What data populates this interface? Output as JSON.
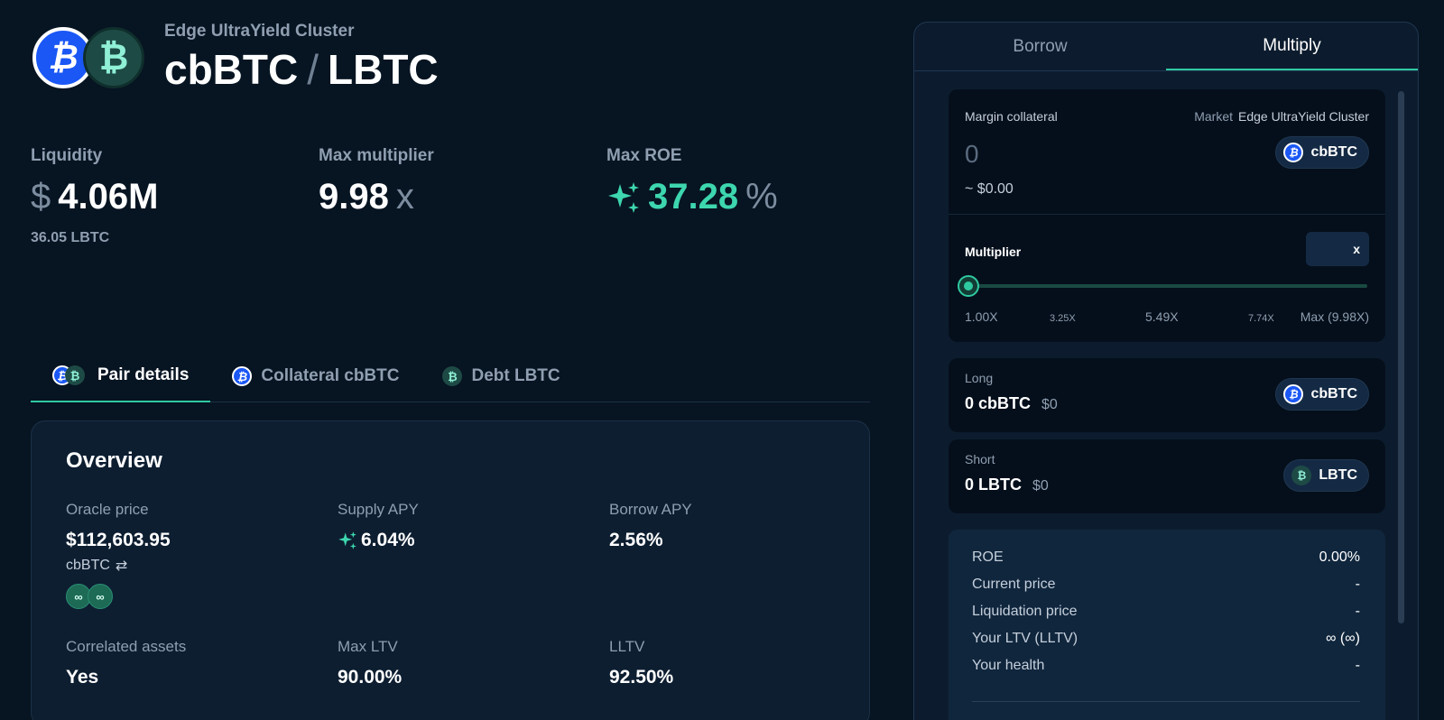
{
  "header": {
    "cluster": "Edge UltraYield Cluster",
    "collateral_symbol": "cbBTC",
    "separator": "/",
    "debt_symbol": "LBTC",
    "collateral_icon": "bitcoin-icon",
    "debt_icon": "lbtc-icon"
  },
  "stats": {
    "liquidity": {
      "label": "Liquidity",
      "prefix": "$",
      "value": "4.06M",
      "sub": "36.05 LBTC"
    },
    "max_multiplier": {
      "label": "Max multiplier",
      "value": "9.98",
      "suffix": "x"
    },
    "max_roe": {
      "label": "Max ROE",
      "value": "37.28",
      "suffix": "%"
    }
  },
  "tabs": [
    {
      "label": "Pair details",
      "active": true
    },
    {
      "label": "Collateral cbBTC",
      "active": false
    },
    {
      "label": "Debt LBTC",
      "active": false
    }
  ],
  "overview": {
    "title": "Overview",
    "oracle_price": {
      "label": "Oracle price",
      "value": "$112,603.95",
      "sub": "cbBTC",
      "swap_glyph": "⇄",
      "oracle_glyph": "∞"
    },
    "supply_apy": {
      "label": "Supply APY",
      "value": "6.04%"
    },
    "borrow_apy": {
      "label": "Borrow APY",
      "value": "2.56%"
    },
    "correlated": {
      "label": "Correlated assets",
      "value": "Yes"
    },
    "max_ltv": {
      "label": "Max LTV",
      "value": "90.00%"
    },
    "lltv": {
      "label": "LLTV",
      "value": "92.50%"
    }
  },
  "panel": {
    "tabs": [
      {
        "label": "Borrow",
        "active": false
      },
      {
        "label": "Multiply",
        "active": true
      }
    ],
    "margin": {
      "label": "Margin collateral",
      "market_label": "Market",
      "market_value": "Edge UltraYield Cluster",
      "placeholder": "0",
      "usd": "~ $0.00",
      "token": "cbBTC"
    },
    "multiplier": {
      "label": "Multiplier",
      "input_suffix": "x",
      "value": 1.0,
      "max": 9.98,
      "ticks": [
        {
          "label": "1.00X",
          "size": "big"
        },
        {
          "label": "3.25X",
          "size": "small"
        },
        {
          "label": "5.49X",
          "size": "big"
        },
        {
          "label": "7.74X",
          "size": "small"
        },
        {
          "label": "Max (9.98X)",
          "size": "big"
        }
      ]
    },
    "long": {
      "label": "Long",
      "amount": "0 cbBTC",
      "usd": "$0",
      "token": "cbBTC"
    },
    "short": {
      "label": "Short",
      "amount": "0 LBTC",
      "usd": "$0",
      "token": "LBTC"
    },
    "summary": [
      {
        "label": "ROE",
        "value": "0.00%"
      },
      {
        "label": "Current price",
        "value": "-"
      },
      {
        "label": "Liquidation price",
        "value": "-"
      },
      {
        "label": "Your LTV (LLTV)",
        "value": "∞ (∞)"
      },
      {
        "label": "Your health",
        "value": "-"
      }
    ]
  },
  "colors": {
    "background": "#071422",
    "accent": "#2fc9a0",
    "cbbtc_blue": "#1a57f5",
    "lbtc_teal": "#1e4a45"
  }
}
